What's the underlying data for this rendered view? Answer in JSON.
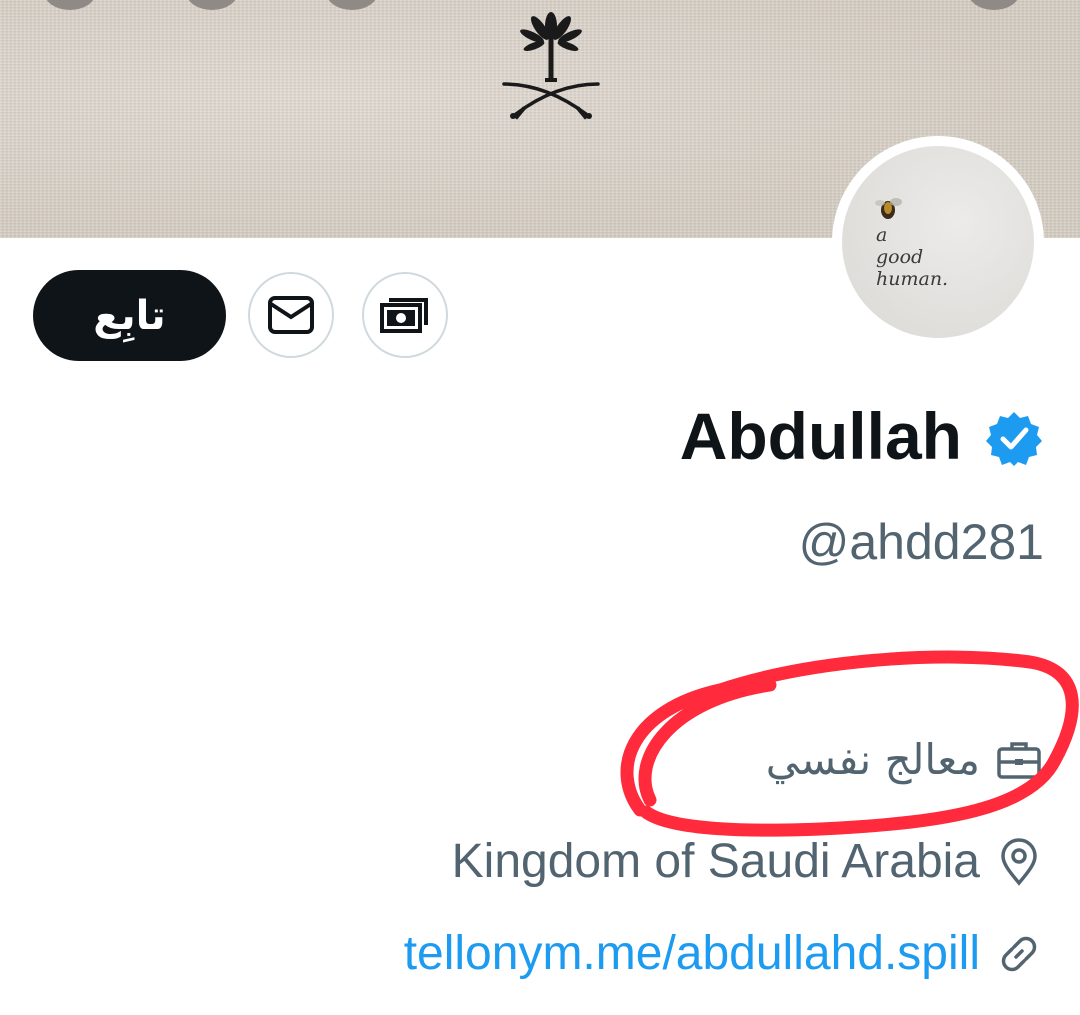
{
  "profile": {
    "display_name": "Abdullah",
    "handle": "@ahdd281",
    "verified": true,
    "avatar_caption": "a\ngood\nhuman.",
    "profession": "معالج نفسي",
    "location": "Kingdom of Saudi Arabia",
    "website": "tellonym.me/abdullahd.spill"
  },
  "actions": {
    "follow_label": "تابِع",
    "message_icon": "mail-icon",
    "tip_icon": "money-icon"
  },
  "banner": {
    "emblem_icon": "palm-swords-emblem-icon"
  },
  "colors": {
    "text_primary": "#0f1419",
    "text_secondary": "#536471",
    "link": "#1d9bf0",
    "verified": "#1d9bf0",
    "annotation": "#ff2a3c",
    "follow_button": "#0f1419"
  }
}
